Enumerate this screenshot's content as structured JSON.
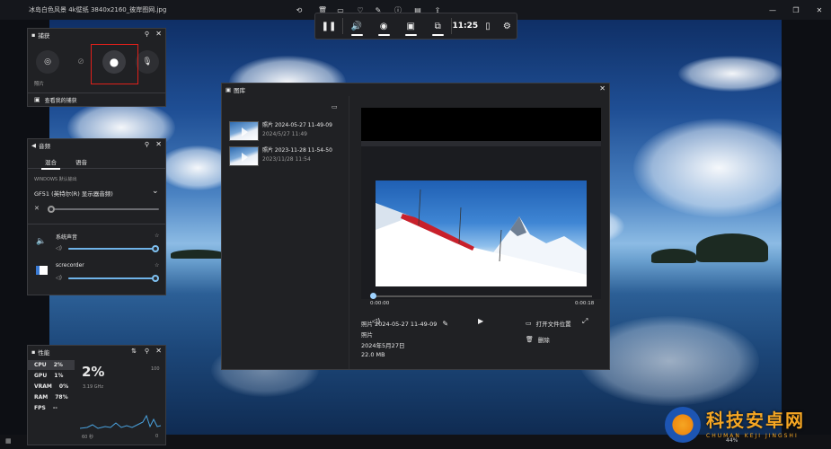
{
  "viewer": {
    "filename": "冰岛白色风景 4k壁纸 3840x2160_彼岸图网.jpg",
    "zoom": "44%"
  },
  "gamebar": {
    "clock": "11:25",
    "icons": [
      "widgets-icon",
      "volume-icon",
      "camera-icon",
      "monitor-icon",
      "gallery-icon",
      "controller-icon",
      "gear-icon"
    ]
  },
  "capture": {
    "title": "捕获",
    "screenshot_label": "照片",
    "see_captures": "查看我的捕获"
  },
  "audio": {
    "title": "音频",
    "tabs": [
      "混合",
      "语音"
    ],
    "default_output_label": "WINDOWS 默认输出",
    "device": "GF51 (英特尔(R) 显示器音频)",
    "apps": [
      {
        "name": "系统声音",
        "level": 1.0
      },
      {
        "name": "screcorder",
        "level": 1.0
      }
    ],
    "master_level": 0.0
  },
  "perf": {
    "title": "性能",
    "metrics": [
      {
        "name": "CPU",
        "value": "2%"
      },
      {
        "name": "GPU",
        "value": "1%"
      },
      {
        "name": "VRAM",
        "value": "0%"
      },
      {
        "name": "RAM",
        "value": "78%"
      },
      {
        "name": "FPS",
        "value": "--"
      }
    ],
    "big_value": "2%",
    "freq": "3.19 GHz",
    "max": "100",
    "window": "60 秒",
    "min": "0"
  },
  "gallery": {
    "title": "图库",
    "items": [
      {
        "name": "照片 2024-05-27 11-49-09",
        "date": "2024/5/27 11:49"
      },
      {
        "name": "照片 2023-11-28 11-54-50",
        "date": "2023/11/28 11:54"
      }
    ],
    "player": {
      "current": "0:00:00",
      "total": "0:00:18"
    },
    "details": {
      "name": "照片 2024-05-27 11-49-09",
      "type": "照片",
      "date": "2024年5月27日",
      "size": "22.0 MB"
    },
    "actions": {
      "open_location": "打开文件位置",
      "delete": "删除"
    }
  },
  "watermark": {
    "text": "科技安卓网",
    "sub": "CHUMAN KEJI JINGSHI"
  },
  "colors": {
    "accent": "#6fb3e8",
    "highlight": "#e0201a",
    "panel": "#202124"
  }
}
